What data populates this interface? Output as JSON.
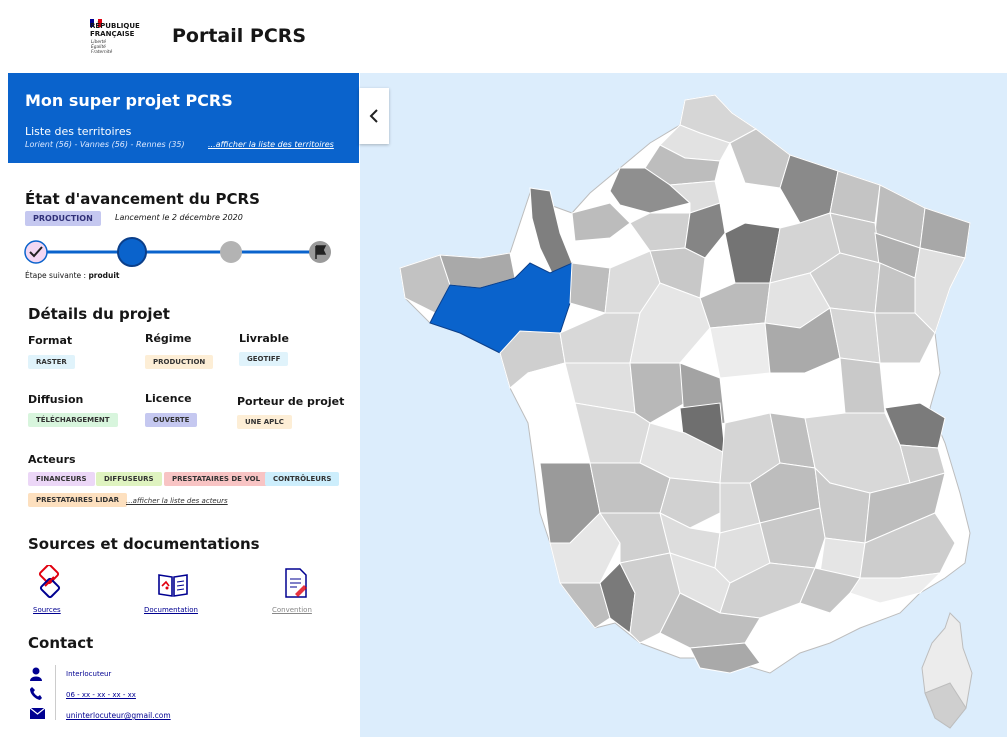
{
  "header": {
    "rf_lines": [
      "RÉPUBLIQUE",
      "FRANÇAISE"
    ],
    "devise": [
      "Liberté",
      "Égalité",
      "Fraternité"
    ],
    "portal_title": "Portail PCRS"
  },
  "project": {
    "title": "Mon super projet PCRS",
    "territories_label": "Liste des territoires",
    "territories_list": "Lorient (56) - Vannes (56) - Rennes (35)",
    "territories_link": "...afficher la liste des territoires"
  },
  "status": {
    "heading": "État d'avancement du PCRS",
    "badge": "PRODUCTION",
    "launch": "Lancement le 2 décembre 2020",
    "next_step_label": "Étape suivante :",
    "next_step_value": "produit"
  },
  "details": {
    "heading": "Détails du projet",
    "format_label": "Format",
    "format_value": "RASTER",
    "regime_label": "Régime",
    "regime_value": "PRODUCTION",
    "livrable_label": "Livrable",
    "livrable_value": "GEOTIFF",
    "diffusion_label": "Diffusion",
    "diffusion_value": "TÉLÉCHARGEMENT",
    "licence_label": "Licence",
    "licence_value": "OUVERTE",
    "porteur_label": "Porteur de projet",
    "porteur_value": "UNE APLC"
  },
  "actors": {
    "heading": "Acteurs",
    "items": [
      "FINANCEURS",
      "DIFFUSEURS",
      "PRESTATAIRES DE VOL",
      "CONTRÔLEURS",
      "PRESTATAIRES LIDAR"
    ],
    "link": "...afficher la liste des acteurs"
  },
  "sources": {
    "heading": "Sources et documentations",
    "sources_label": "Sources",
    "documentation_label": "Documentation",
    "convention_label": "Convention"
  },
  "contact": {
    "heading": "Contact",
    "name": "Interlocuteur",
    "phone": "06 - xx - xx - xx - xx",
    "email": "uninterlocuteur@gmail.com"
  },
  "colors": {
    "brand_blue": "#0a63cc",
    "marianne_blue": "#000091",
    "marianne_red": "#e1000f",
    "progress_blue": "#0a63cc",
    "map_sea": "#dcedfc"
  }
}
